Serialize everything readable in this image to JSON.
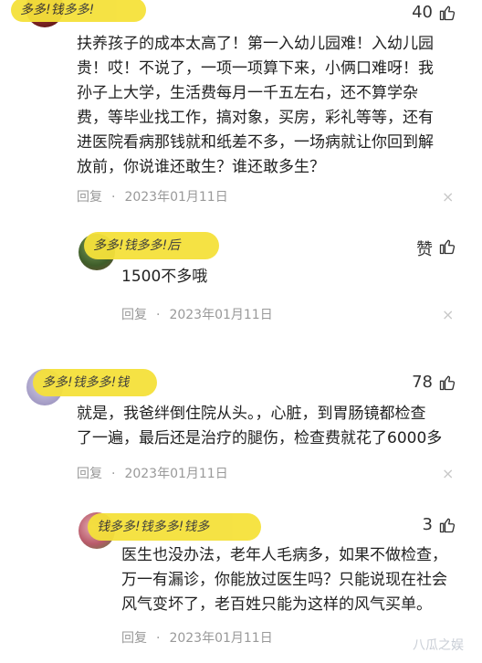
{
  "comments": [
    {
      "user_badge": "多多!钱多多!",
      "likes": "40",
      "text_lines": [
        "扶养孩子的成本太高了！第一入幼儿园难！入幼儿园",
        "贵！哎！不说了，一项一项算下来，小俩口难呀！我",
        "孙子上大学，生活费每月一千五左右，还不算学杂",
        "费，等毕业找工作，搞对象，买房，彩礼等等，还有",
        "进医院看病那钱就和纸差不多，一场病就让你回到解",
        "放前，你说谁还敢生？谁还敢多生？"
      ],
      "reply_label": "回复",
      "date": "2023年01月11日"
    },
    {
      "user_badge": "多多!钱多多!后",
      "likes": "赞",
      "text_lines": [
        "1500不多哦"
      ],
      "reply_label": "回复",
      "date": "2023年01月11日"
    },
    {
      "user_badge": "多多!钱多多!钱",
      "likes": "78",
      "text_lines": [
        "就是，我爸绊倒住院从头。，心脏，到胃肠镜都检查",
        "了一遍，最后还是治疗的腿伤，检查费就花了6000多"
      ],
      "reply_label": "回复",
      "date": "2023年01月11日"
    },
    {
      "user_badge": "钱多多!钱多多!钱多",
      "likes": "3",
      "text_lines": [
        "医生也没办法，老年人毛病多，如果不做检查，",
        "万一有漏诊，你能放过医生吗？只能说现在社会",
        "风气变坏了，老百姓只能为这样的风气买单。"
      ],
      "reply_label": "回复",
      "date": "2023年01月11日"
    }
  ],
  "icons": {
    "like": "thumbs-up-icon",
    "close": "close-icon"
  },
  "close_glyph": "×",
  "separator": "·",
  "watermark": "八瓜之娱"
}
